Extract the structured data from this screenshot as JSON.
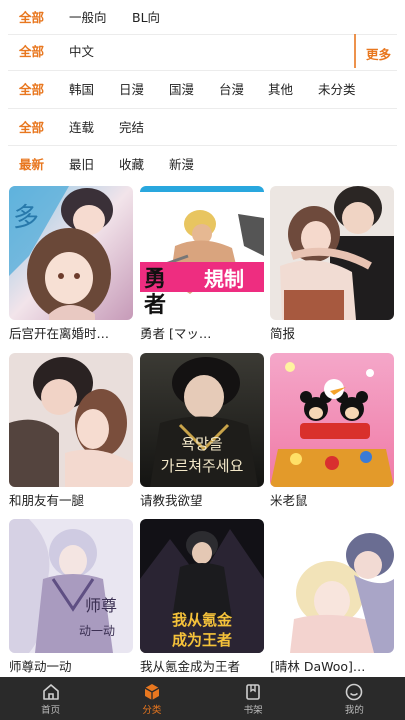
{
  "filters": {
    "audience": {
      "all_label": "全部",
      "options": [
        "一般向",
        "BL向"
      ]
    },
    "language": {
      "all_label": "全部",
      "options": [
        "中文"
      ],
      "more_label": "更多"
    },
    "region": {
      "all_label": "全部",
      "options": [
        "韩国",
        "日漫",
        "国漫",
        "台漫",
        "其他",
        "未分类"
      ]
    },
    "status": {
      "all_label": "全部",
      "options": [
        "连载",
        "完结"
      ]
    },
    "sort": {
      "active_label": "最新",
      "options": [
        "最旧",
        "收藏",
        "新漫"
      ]
    }
  },
  "comics": [
    {
      "title": "后宫开在离婚时…"
    },
    {
      "title": "勇者 [マッ…",
      "cover_text": [
        "勇",
        "者",
        "規制"
      ]
    },
    {
      "title": "简报"
    },
    {
      "title": "和朋友有一腿"
    },
    {
      "title": "请教我欲望",
      "cover_text": [
        "욕망을",
        "가르쳐주세요"
      ]
    },
    {
      "title": "米老鼠"
    },
    {
      "title": "师尊动一动",
      "cover_text": [
        "师尊",
        "动一动"
      ]
    },
    {
      "title": "我从氪金成为王者",
      "cover_text": [
        "我从氪金",
        "成为王者"
      ]
    },
    {
      "title": "[晴林 DaWoo]…"
    }
  ],
  "tabbar": {
    "items": [
      {
        "label": "首页",
        "icon": "home-icon"
      },
      {
        "label": "分类",
        "icon": "category-cube-icon"
      },
      {
        "label": "书架",
        "icon": "bookshelf-icon"
      },
      {
        "label": "我的",
        "icon": "profile-icon"
      }
    ],
    "active_index": 1
  },
  "colors": {
    "accent": "#e8771f",
    "tabbar_bg": "#2a2a2a"
  }
}
